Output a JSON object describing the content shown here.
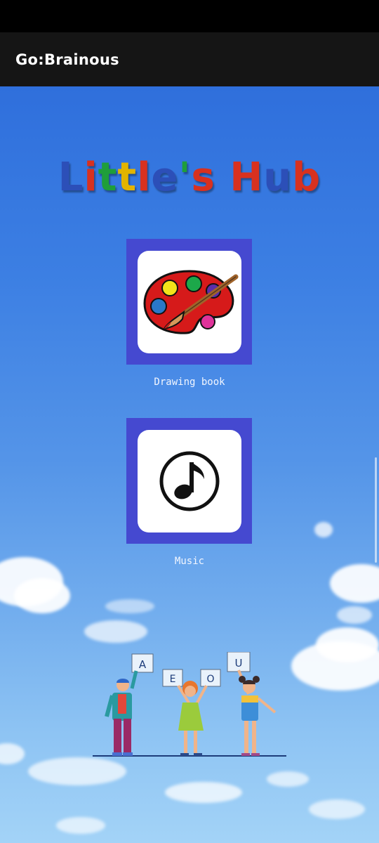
{
  "app_bar": {
    "title": "Go:Brainous"
  },
  "hub_title": [
    "L",
    "i",
    "t",
    "t",
    "l",
    "e",
    "'",
    "s",
    " ",
    "H",
    "u",
    "b"
  ],
  "hub_colors": [
    "#2c4fb8",
    "#d8311f",
    "#1f9e3a",
    "#e3b400",
    "#d8311f",
    "#2c4fb8",
    "#1f9e3a",
    "#d8311f",
    "#2c4fb8",
    "#d8311f",
    "#2c4fb8",
    "#d8311f"
  ],
  "tiles": [
    {
      "label": "Drawing book",
      "icon": "paint-palette-icon"
    },
    {
      "label": "Music",
      "icon": "music-note-icon"
    }
  ],
  "illustration": {
    "cards": [
      "A",
      "E",
      "O",
      "U"
    ],
    "icon": "kids-holding-letters-icon"
  }
}
